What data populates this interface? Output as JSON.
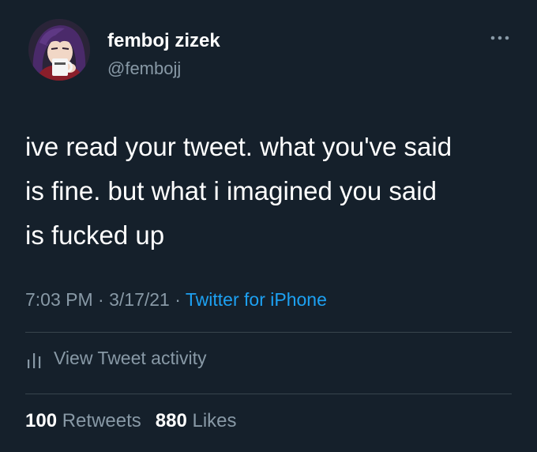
{
  "tweet": {
    "author": {
      "display_name": "femboj zizek",
      "handle": "@fembojj",
      "avatar_icon": "anime-avatar-with-mug"
    },
    "more_icon": "more-options-icon",
    "text": "ive read your tweet. what you've said\nis fine. but what i imagined you said\nis fucked up",
    "meta": {
      "time": "7:03 PM",
      "separator": " · ",
      "date": "3/17/21",
      "source": "Twitter for iPhone"
    },
    "activity": {
      "icon": "analytics-bars-icon",
      "label": "View Tweet activity"
    },
    "stats": {
      "retweets_count": "100",
      "retweets_label": "Retweets",
      "likes_count": "880",
      "likes_label": "Likes"
    }
  },
  "colors": {
    "background": "#15202b",
    "primary_text": "#ffffff",
    "secondary_text": "#8899a6",
    "accent": "#1da1f2",
    "divider": "#38444d"
  }
}
